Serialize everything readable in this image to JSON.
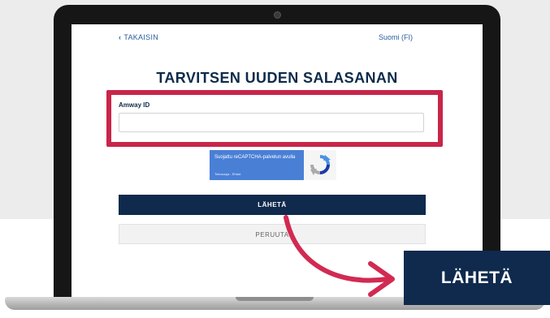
{
  "nav": {
    "back_label": "TAKAISIN",
    "language": "Suomi (FI)"
  },
  "form": {
    "title": "TARVITSEN UUDEN SALASANAN",
    "amway_id_label": "Amway ID",
    "amway_id_value": "",
    "submit_label": "LÄHETÄ",
    "cancel_label": "PERUUTA"
  },
  "captcha": {
    "text": "Suojattu reCAPTCHA-palvelun avulla",
    "links": "Tietosuoja - Ehdot"
  },
  "callout": {
    "label": "LÄHETÄ"
  },
  "colors": {
    "highlight": "#c8254a",
    "primary_button": "#0f2a4d",
    "link": "#2a5d9f"
  }
}
